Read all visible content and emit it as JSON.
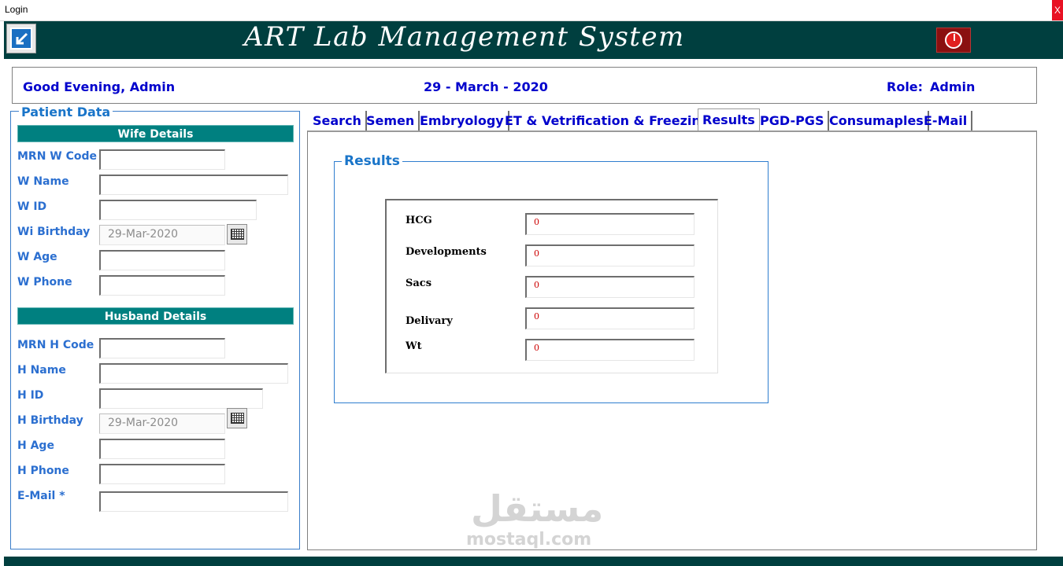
{
  "window": {
    "title": "Login",
    "close_label": "X"
  },
  "header": {
    "app_title": "ART Lab Management System",
    "exit_icon": "exit-arrow-icon",
    "power_icon": "power-icon",
    "colors": {
      "band": "#003f3f",
      "accent": "#008080"
    }
  },
  "greeting": {
    "text": "Good Evening, Admin",
    "date": "29 - March - 2020",
    "role_label": "Role:",
    "role_value": "Admin"
  },
  "patient": {
    "legend": "Patient Data",
    "wife": {
      "title": "Wife Details",
      "mrn_label": "MRN W Code",
      "mrn_value": "",
      "name_label": "W Name",
      "name_value": "",
      "id_label": "W ID",
      "id_value": "",
      "birthday_label": "Wi Birthday",
      "birthday_value": "29-Mar-2020",
      "age_label": "W Age",
      "age_value": "",
      "phone_label": "W Phone",
      "phone_value": ""
    },
    "husband": {
      "title": "Husband Details",
      "mrn_label": "MRN H Code",
      "mrn_value": "",
      "name_label": "H Name",
      "name_value": "",
      "id_label": "H ID",
      "id_value": "",
      "birthday_label": "H Birthday",
      "birthday_value": "29-Mar-2020",
      "age_label": "H Age",
      "age_value": "",
      "phone_label": "H Phone",
      "phone_value": "",
      "email_label": "E-Mail *",
      "email_value": ""
    }
  },
  "tabs": [
    {
      "label": "Search"
    },
    {
      "label": "Semen"
    },
    {
      "label": "Embryology"
    },
    {
      "label": "ET & Vetrification & Freezing"
    },
    {
      "label": "Results",
      "active": true
    },
    {
      "label": "PGD-PGS"
    },
    {
      "label": "Consumaples"
    },
    {
      "label": "E-Mail"
    }
  ],
  "results": {
    "legend": "Results",
    "fields": [
      {
        "label": "HCG",
        "value": "0"
      },
      {
        "label": "Developments",
        "value": "0"
      },
      {
        "label": "Sacs",
        "value": "0"
      },
      {
        "label": "Delivary",
        "value": "0"
      },
      {
        "label": "Wt",
        "value": "0"
      }
    ]
  },
  "watermark": {
    "arabic": "مستقل",
    "latin": "mostaql.com"
  }
}
